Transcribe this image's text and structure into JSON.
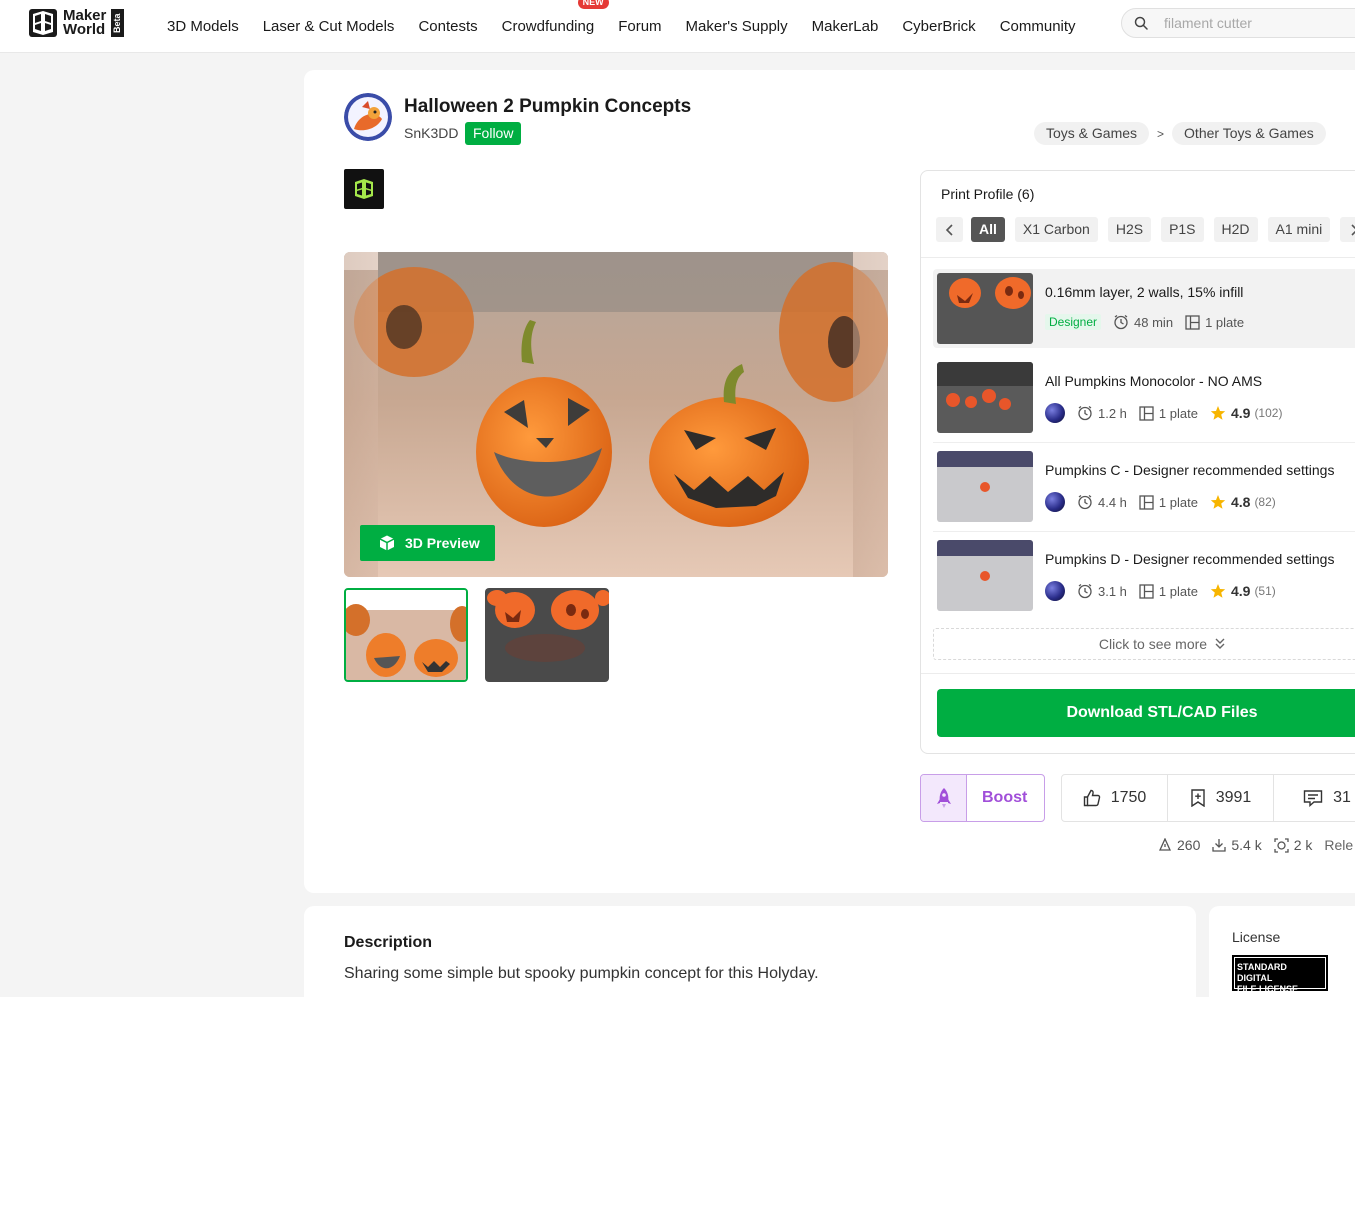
{
  "header": {
    "logo_line1": "Maker",
    "logo_line2": "World",
    "logo_badge": "Beta",
    "nav": [
      "3D Models",
      "Laser & Cut Models",
      "Contests",
      "Crowdfunding",
      "Forum",
      "Maker's Supply",
      "MakerLab",
      "CyberBrick",
      "Community"
    ],
    "nav_badge": "NEW",
    "search_placeholder": "filament cutter"
  },
  "model": {
    "title": "Halloween 2 Pumpkin Concepts",
    "author": "SnK3DD",
    "follow_label": "Follow",
    "breadcrumb": [
      "Toys & Games",
      "Other Toys & Games"
    ],
    "preview_button": "3D Preview"
  },
  "print_profile": {
    "title": "Print Profile (6)",
    "filters": [
      "All",
      "X1 Carbon",
      "H2S",
      "P1S",
      "H2D",
      "A1 mini"
    ],
    "active_filter": "All",
    "profiles": [
      {
        "name": "0.16mm layer, 2 walls, 15% infill",
        "tag": "Designer",
        "time": "48 min",
        "plates": "1 plate"
      },
      {
        "name": "All Pumpkins Monocolor - NO AMS",
        "time": "1.2 h",
        "plates": "1 plate",
        "rating": "4.9",
        "count": "(102)"
      },
      {
        "name": "Pumpkins C - Designer recommended settings",
        "time": "4.4 h",
        "plates": "1 plate",
        "rating": "4.8",
        "count": "(82)"
      },
      {
        "name": "Pumpkins D - Designer recommended settings",
        "time": "3.1 h",
        "plates": "1 plate",
        "rating": "4.9",
        "count": "(51)"
      }
    ],
    "see_more": "Click to see more",
    "download_label": "Download STL/CAD Files"
  },
  "actions": {
    "boost_label": "Boost",
    "likes": "1750",
    "collects": "3991",
    "comments": "31"
  },
  "mini_stats": {
    "boosts": "260",
    "downloads": "5.4 k",
    "prints": "2 k",
    "release_label": "Rele"
  },
  "description": {
    "heading": "Description",
    "text": "Sharing some simple but spooky pumpkin concept for this Holyday."
  },
  "license": {
    "label": "License",
    "badge_line1": "STANDARD DIGITAL",
    "badge_line2": "FILE LICENSE"
  },
  "colors": {
    "brand_green": "#00ae42",
    "boost_purple": "#a14fd9",
    "page_bg": "#f4f4f4"
  }
}
